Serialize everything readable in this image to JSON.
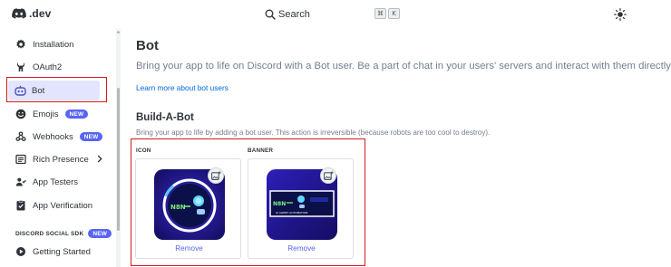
{
  "topbar": {
    "logo_text": ".dev",
    "search_label": "Search",
    "shortcut_keys": [
      "⌘",
      "K"
    ]
  },
  "sidebar": {
    "items": [
      {
        "label": "Installation",
        "icon": "gear-icon"
      },
      {
        "label": "OAuth2",
        "icon": "wrench-icon"
      },
      {
        "label": "Bot",
        "icon": "bot-icon",
        "active": true
      },
      {
        "label": "Emojis",
        "icon": "emoji-icon",
        "badge": "NEW"
      },
      {
        "label": "Webhooks",
        "icon": "webhooks-icon",
        "badge": "NEW"
      },
      {
        "label": "Rich Presence",
        "icon": "rich-presence-icon",
        "chevron": "›"
      },
      {
        "label": "App Testers",
        "icon": "testers-icon"
      },
      {
        "label": "App Verification",
        "icon": "verification-icon"
      },
      {
        "label": "Getting Started",
        "icon": "getting-started-icon"
      }
    ],
    "section_label": "DISCORD SOCIAL SDK",
    "section_badge": "NEW"
  },
  "main": {
    "title": "Bot",
    "description": "Bring your app to life on Discord with a Bot user. Be a part of chat in your users' servers and interact with them directly.",
    "learn_more": "Learn more about bot users",
    "build_title": "Build-A-Bot",
    "build_description": "Bring your app to life by adding a bot user. This action is irreversible (because robots are too cool to destroy).",
    "icon_label": "ICON",
    "banner_label": "BANNER",
    "remove_label": "Remove",
    "banner_caption": "AI AGENT AUTOMATION"
  },
  "colors": {
    "accent": "#5865f2",
    "link": "#0068e0",
    "highlight_border": "#d31a1a",
    "active_bg": "#e3e5ff"
  }
}
